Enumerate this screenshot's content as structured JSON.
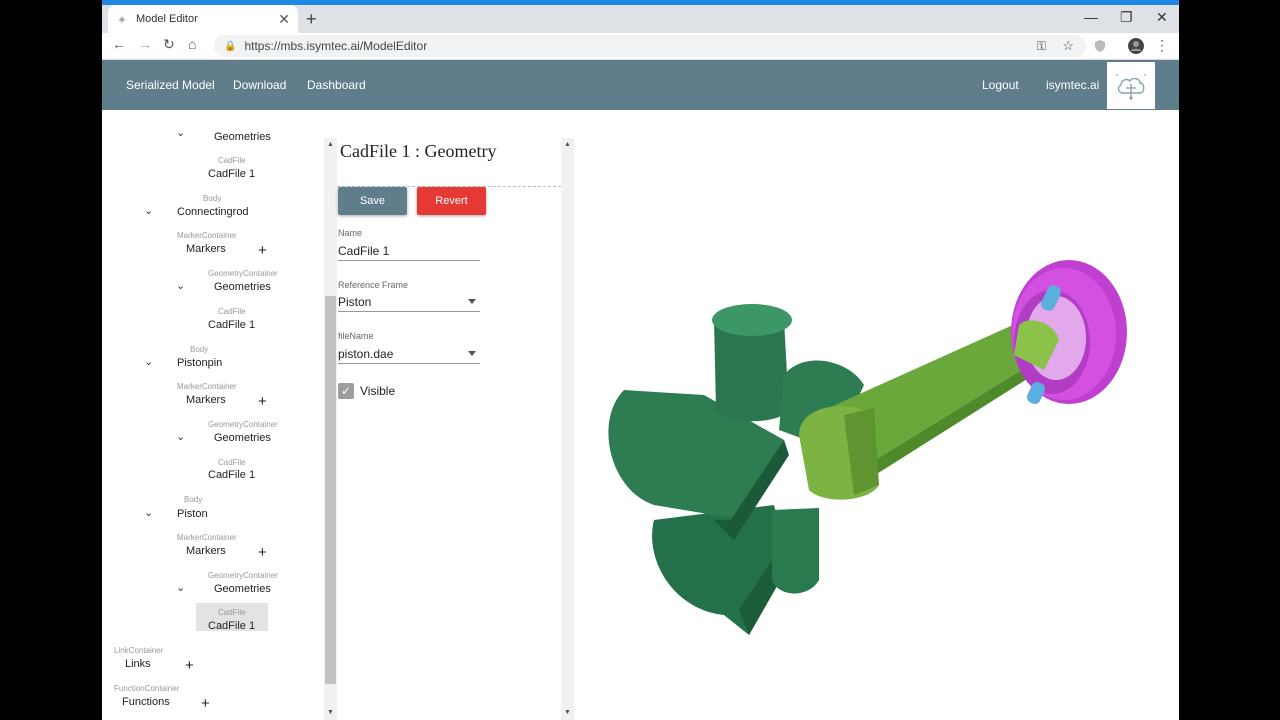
{
  "browser": {
    "tab_title": "Model Editor",
    "new_tab_icon": "plus-icon",
    "url": "https://mbs.isymtec.ai/ModelEditor",
    "window_controls": [
      "minimize",
      "restore",
      "close"
    ]
  },
  "appbar": {
    "nav": [
      "Serialized Model",
      "Download",
      "Dashboard"
    ],
    "logout": "Logout",
    "brand": "isymtec.ai",
    "logo_icon": "cloud-logo-icon",
    "background": "#607d8b"
  },
  "tree": {
    "partial_top_label": "Geometries",
    "cadfile_type": "CadFile",
    "cadfile_name": "CadFile 1",
    "body_type": "Body",
    "marker_type": "MarkerContainer",
    "markers_label": "Markers",
    "geometry_type": "GeometryContainer",
    "geometries_label": "Geometries",
    "bodies": [
      "Connectingrod",
      "Pistonpin",
      "Piston"
    ],
    "link_type": "LinkContainer",
    "links_label": "Links",
    "function_type": "FunctionContainer",
    "functions_label": "Functions"
  },
  "form": {
    "title": "CadFile 1 : Geometry",
    "save": "Save",
    "revert": "Revert",
    "name_label": "Name",
    "name_value": "CadFile 1",
    "ref_label": "Reference Frame",
    "ref_value": "Piston",
    "file_label": "fileName",
    "file_value": "piston.dae",
    "visible_label": "Visible",
    "visible_checked": true,
    "save_color": "#607d8b",
    "revert_color": "#e53935"
  },
  "viewport": {
    "green": "#2e7d52",
    "light_green": "#7cb342",
    "magenta": "#d450e0",
    "pin_blue": "#5aaee0"
  }
}
